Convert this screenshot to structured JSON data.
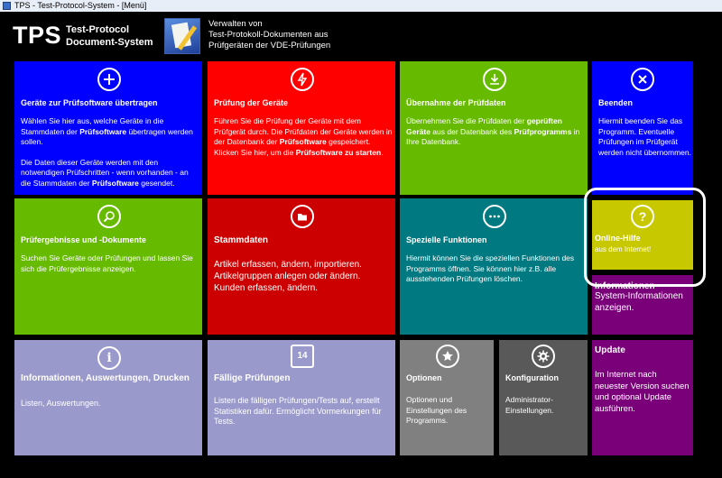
{
  "window": {
    "title": "TPS - Test-Protocol-System - [Menü]"
  },
  "header": {
    "logo": "TPS",
    "logo_sub_1": "Test-Protocol",
    "logo_sub_2": "Document-System",
    "desc_1": "Verwalten von",
    "desc_2": "Test-Protokoll-Dokumenten aus",
    "desc_3": "Prüfgeräten der VDE-Prüfungen"
  },
  "tiles": {
    "geraete": {
      "title": "Geräte zur Prüfsoftware übertragen",
      "p1a": "Wählen Sie hier aus, welche Geräte in die Stammdaten der ",
      "p1b": "Prüfsoftware",
      "p1c": " übertragen werden sollen.",
      "p2a": "Die Daten dieser Geräte werden mit den notwendigen Prüfschritten - wenn vorhanden - an die Stammdaten  der ",
      "p2b": "Prüfsoftware",
      "p2c": " gesendet.",
      "color": "#0000ff"
    },
    "pruefung": {
      "title": "Prüfung der Geräte",
      "d1": "Führen Sie die Prüfung der Geräte mit dem Prüfgerät durch. Die Prüfdaten der Geräte werden in der Datenbank der ",
      "d2": "Prüfsoftware",
      "d3": " gespeichert. Klicken Sie hier, um die ",
      "d4": "Prüfsoftware zu starten",
      "d5": ".",
      "color": "#ff0000"
    },
    "uebernahme": {
      "title": "Übernahme der Prüfdaten",
      "d1": "Übernehmen Sie die Prüfdaten der ",
      "d2": "geprüften Geräte",
      "d3": " aus der Datenbank des ",
      "d4": "Prüfprogramms",
      "d5": " in Ihre Datenbank.",
      "color": "#66bb00"
    },
    "beenden": {
      "title": "Beenden",
      "desc": "Hiermit beenden Sie das Programm. Eventuelle Prüfungen im Prüfgerät werden nicht übernommen.",
      "color": "#0000ff"
    },
    "ergebnisse": {
      "title": "Prüfergebnisse und -Dokumente",
      "desc": "Suchen Sie Geräte oder Prüfungen und lassen Sie sich die Prüfergebnisse anzeigen.",
      "color": "#66bb00"
    },
    "stammdaten": {
      "title": "Stammdaten",
      "l1": "Artikel erfassen, ändern, importieren.",
      "l2": "Artikelgruppen anlegen oder ändern.",
      "l3": "Kunden erfassen, ändern.",
      "color": "#cc0000"
    },
    "spezielle": {
      "title": "Spezielle Funktionen",
      "desc": "Hiermit können Sie die speziellen Funktionen des Programms öffnen. Sie können hier z.B. alle ausstehenden Prüfungen löschen.",
      "color": "#007a80"
    },
    "hilfe": {
      "title": "Online-Hilfe",
      "desc": "aus dem Internet!",
      "color": "#c8c800"
    },
    "info_purple": {
      "title": "Informationen",
      "desc": "System-Informationen anzeigen.",
      "color": "#7a007a"
    },
    "informationen": {
      "title": "Informationen, Auswertungen, Drucken",
      "desc": "Listen, Auswertungen.",
      "color": "#9999cc"
    },
    "faellige": {
      "title": "Fällige Prüfungen",
      "desc": "Listen die fälligen Prüfungen/Tests auf, erstellt Statistiken dafür. Ermöglicht Vormerkungen für Tests.",
      "icon_text": "14",
      "color": "#9999cc"
    },
    "optionen": {
      "title": "Optionen",
      "desc": "Optionen und Einstellungen des Programms.",
      "color": "#808080"
    },
    "konfiguration": {
      "title": "Konfiguration",
      "desc": "Administrator-Einstellungen.",
      "color": "#595959"
    },
    "update": {
      "title": "Update",
      "desc": "Im Internet nach neuester Version suchen und optional Update ausführen.",
      "color": "#7a007a"
    }
  },
  "icons": {
    "plus": "plus-icon",
    "lightning": "lightning-icon",
    "download": "download-icon",
    "close": "close-icon",
    "search": "search-icon",
    "folder": "folder-icon",
    "more": "more-icon",
    "help": "help-icon",
    "info": "info-icon",
    "calendar": "calendar-icon",
    "star": "star-icon",
    "gear": "gear-icon"
  }
}
